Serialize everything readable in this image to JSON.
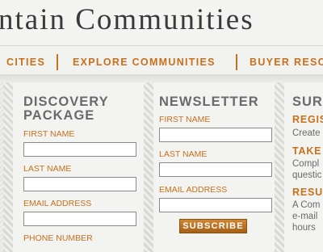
{
  "brand": {
    "title": "ntain Communities"
  },
  "nav": {
    "items": [
      "CITIES",
      "EXPLORE COMMUNITIES",
      "BUYER RESO"
    ]
  },
  "discovery": {
    "heading_line1": "DISCOVERY",
    "heading_line2": "PACKAGE",
    "fields": {
      "first_name": "FIRST NAME",
      "last_name": "LAST NAME",
      "email": "EMAIL ADDRESS",
      "phone": "PHONE NUMBER"
    }
  },
  "newsletter": {
    "heading": "NEWSLETTER",
    "fields": {
      "first_name": "FIRST NAME",
      "last_name": "LAST NAME",
      "email": "EMAIL ADDRESS"
    },
    "subscribe_label": "SUBSCRIBE"
  },
  "third": {
    "heading": "SUR",
    "items": [
      {
        "title": "REGIS",
        "lines": [
          "Create"
        ]
      },
      {
        "title": "TAKE",
        "lines": [
          "Compl",
          "questic"
        ]
      },
      {
        "title": "RESU",
        "lines": [
          "A Com",
          "e-mail",
          "hours"
        ]
      }
    ]
  }
}
